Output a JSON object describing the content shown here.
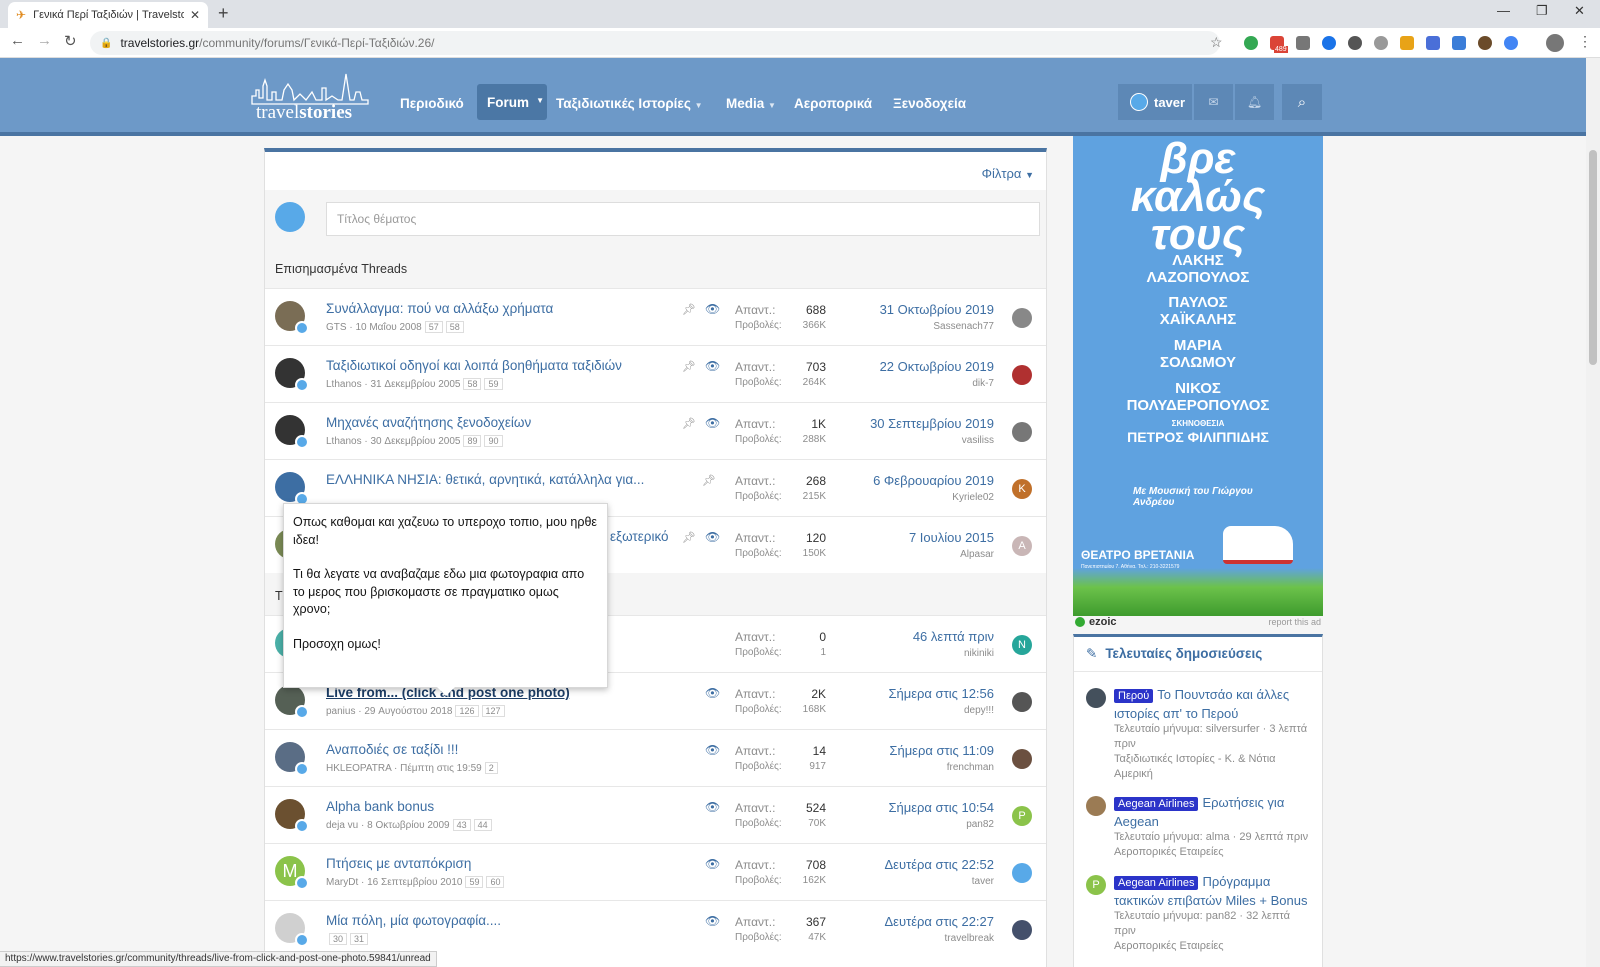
{
  "browser": {
    "tab_title": "Γενικά Περί Ταξιδιών | Travelsto",
    "url_domain": "travelstories.gr",
    "url_path": "/community/forums/Γενικά-Περί-Ταξιδιών.26/",
    "ext_badge_1": "489",
    "status_url": "https://www.travelstories.gr/community/threads/live-from-click-and-post-one-photo.59841/unread"
  },
  "header": {
    "logo_text_a": "travel",
    "logo_text_b": "stories",
    "nav": [
      "Περιοδικό",
      "Forum",
      "Ταξιδιωτικές Ιστορίες",
      "Media",
      "Αεροπορικά",
      "Ξενοδοχεία"
    ],
    "username": "taver"
  },
  "main": {
    "filters_label": "Φίλτρα",
    "title_placeholder": "Τίτλος θέματος",
    "featured_heading": "Επισημασμένα Threads",
    "threads_heading_fragment": "T",
    "replies_label": "Απαντ.:",
    "views_label": "Προβολές:",
    "featured": [
      {
        "title": "Συνάλλαγμα: πού να αλλάξω χρήματα",
        "author": "GTS",
        "date": "10 Μαΐου 2008",
        "p1": "57",
        "p2": "58",
        "replies": "688",
        "views": "366K",
        "last_date": "31 Οκτωβρίου 2019",
        "last_user": "Sassenach77"
      },
      {
        "title": "Ταξιδιωτικοί οδηγοί και λοιπά βοηθήματα ταξιδιών",
        "author": "Lthanos",
        "date": "31 Δεκεμβρίου 2005",
        "p1": "58",
        "p2": "59",
        "replies": "703",
        "views": "264K",
        "last_date": "22 Οκτωβρίου 2019",
        "last_user": "dik-7"
      },
      {
        "title": "Μηχανές αναζήτησης ξενοδοχείων",
        "author": "Lthanos",
        "date": "30 Δεκεμβρίου 2005",
        "p1": "89",
        "p2": "90",
        "replies": "1K",
        "views": "288K",
        "last_date": "30 Σεπτεμβρίου 2019",
        "last_user": "vasiliss"
      },
      {
        "title": "ΕΛΛΗΝΙΚΑ ΝΗΣΙΑ: θετικά, αρνητικά, κατάλληλα για...",
        "author": "",
        "date": "",
        "p1": "",
        "p2": "",
        "replies": "268",
        "views": "215K",
        "last_date": "6 Φεβρουαρίου 2019",
        "last_user": "Kyriele02",
        "last_initial": "K"
      },
      {
        "title": "εξωτερικό",
        "author": "",
        "date": "",
        "p1": "",
        "p2": "",
        "replies": "120",
        "views": "150K",
        "last_date": "7 Ιουλίου 2015",
        "last_user": "Alpasar",
        "last_initial": "A"
      }
    ],
    "threads": [
      {
        "title": "",
        "author": "",
        "date": "",
        "p1": "",
        "p2": "",
        "replies": "0",
        "views": "1",
        "last_date": "46 λεπτά πριν",
        "last_user": "nikiniki",
        "last_initial": "N"
      },
      {
        "title": "Live from... (click and post one photo)",
        "author": "panius",
        "date": "29 Αυγούστου 2018",
        "p1": "126",
        "p2": "127",
        "replies": "2K",
        "views": "168K",
        "last_date": "Σήμερα στις 12:56",
        "last_user": "depy!!!"
      },
      {
        "title": "Αναποδιές σε ταξίδι !!!",
        "author": "HKLEOPATRA",
        "date": "Πέμπτη στις 19:59",
        "p1": "2",
        "p2": "",
        "replies": "14",
        "views": "917",
        "last_date": "Σήμερα στις 11:09",
        "last_user": "frenchman"
      },
      {
        "title": "Alpha bank bonus",
        "author": "deja vu",
        "date": "8 Οκτωβρίου 2009",
        "p1": "43",
        "p2": "44",
        "replies": "524",
        "views": "70K",
        "last_date": "Σήμερα στις 10:54",
        "last_user": "pan82",
        "last_initial": "P"
      },
      {
        "title": "Πτήσεις με ανταπόκριση",
        "author": "MaryDt",
        "date": "16 Σεπτεμβρίου 2010",
        "p1": "59",
        "p2": "60",
        "replies": "708",
        "views": "162K",
        "last_date": "Δευτέρα στις 22:52",
        "last_user": "taver",
        "author_initial": "M"
      },
      {
        "title": "Μία πόλη, μία φωτογραφία....",
        "author": "",
        "date": "",
        "p1": "30",
        "p2": "31",
        "replies": "367",
        "views": "47K",
        "last_date": "Δευτέρα στις 22:27",
        "last_user": "travelbreak"
      }
    ]
  },
  "tooltip": {
    "p1": "Οπως καθομαι και χαζευω το υπεροχο τοπιο, μου ηρθε ιδεα!",
    "p2": "Τι θα λεγατε να αναβαζαμε εδω μια φωτογραφια απο το μερος που βρισκομαστε σε πραγματικο ομως χρονο;",
    "p3": "Προσοχη ομως!"
  },
  "ad": {
    "l1": "βρε",
    "l2": "καλώς",
    "l3": "τους",
    "names": [
      "ΛΑΚΗΣ",
      "ΛΑΖΟΠΟΥΛΟΣ",
      "ΠΑΥΛΟΣ",
      "ΧΑΪΚΑΛΗΣ",
      "ΜΑΡΙΑ",
      "ΣΟΛΩΜΟΥ",
      "ΝΙΚΟΣ",
      "ΠΟΛΥΔΕΡΟΠΟΥΛΟΣ"
    ],
    "direction_label": "ΣΚΗΝΟΘΕΣΙΑ",
    "director": "ΠΕΤΡΟΣ ΦΙΛΙΠΠΙΔΗΣ",
    "music": "Με Μουσική του Γιώργου Ανδρέου",
    "theatre": "ΘΕΑΤΡΟ ΒΡΕΤΑΝΙΑ",
    "address": "Πανεπιστημίου 7, Αθήνα, Τηλ.: 210-3221579",
    "ezoic": "ezoic",
    "report": "report this ad"
  },
  "latest": {
    "heading": "Τελευταίες δημοσιεύσεις",
    "posts": [
      {
        "tag": "Περού",
        "title": "Το Πουντσάο και άλλες ιστορίες απ' το Περού",
        "meta": "Τελευταίο μήνυμα: silversurfer · 3 λεπτά πριν",
        "forum": "Ταξιδιωτικές Ιστορίες - Κ. & Νότια Αμερική"
      },
      {
        "tag": "Aegean Airlines",
        "title": "Ερωτήσεις για Aegean",
        "meta": "Τελευταίο μήνυμα: alma · 29 λεπτά πριν",
        "forum": "Αεροπορικές Εταιρείες"
      },
      {
        "tag": "Aegean Airlines",
        "title": "Πρόγραμμα τακτικών επιβατών Miles + Bonus",
        "meta": "Τελευταίο μήνυμα: pan82 · 32 λεπτά πριν",
        "forum": "Αεροπορικές Εταιρείες",
        "initial": "P"
      }
    ]
  },
  "colors": {
    "header": "#6d99c8",
    "link": "#3d6ea3",
    "accent": "#4a74a2",
    "tag": "#2b34c9"
  }
}
